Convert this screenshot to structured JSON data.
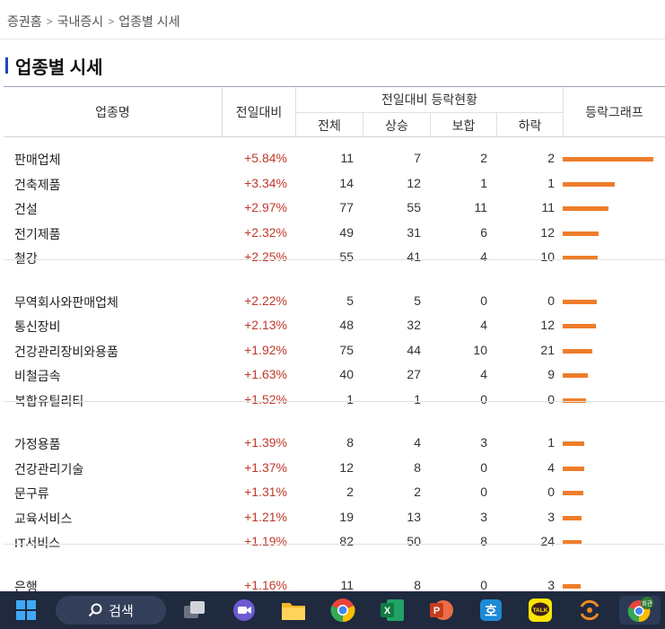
{
  "breadcrumb": [
    "증권홈",
    "국내증시",
    "업종별 시세"
  ],
  "page_title": "업종별 시세",
  "table": {
    "headers": {
      "name": "업종명",
      "change": "전일대비",
      "group": "전일대비 등락현황",
      "total": "전체",
      "up": "상승",
      "flat": "보합",
      "down": "하락",
      "graph": "등락그래프"
    },
    "groups": [
      [
        {
          "name": "판매업체",
          "change": "+5.84%",
          "total": "11",
          "up": "7",
          "flat": "2",
          "down": "2",
          "pct": 5.84
        },
        {
          "name": "건축제품",
          "change": "+3.34%",
          "total": "14",
          "up": "12",
          "flat": "1",
          "down": "1",
          "pct": 3.34
        },
        {
          "name": "건설",
          "change": "+2.97%",
          "total": "77",
          "up": "55",
          "flat": "11",
          "down": "11",
          "pct": 2.97
        },
        {
          "name": "전기제품",
          "change": "+2.32%",
          "total": "49",
          "up": "31",
          "flat": "6",
          "down": "12",
          "pct": 2.32
        },
        {
          "name": "철강",
          "change": "+2.25%",
          "total": "55",
          "up": "41",
          "flat": "4",
          "down": "10",
          "pct": 2.25
        }
      ],
      [
        {
          "name": "무역회사와판매업체",
          "change": "+2.22%",
          "total": "5",
          "up": "5",
          "flat": "0",
          "down": "0",
          "pct": 2.22
        },
        {
          "name": "통신장비",
          "change": "+2.13%",
          "total": "48",
          "up": "32",
          "flat": "4",
          "down": "12",
          "pct": 2.13
        },
        {
          "name": "건강관리장비와용품",
          "change": "+1.92%",
          "total": "75",
          "up": "44",
          "flat": "10",
          "down": "21",
          "pct": 1.92
        },
        {
          "name": "비철금속",
          "change": "+1.63%",
          "total": "40",
          "up": "27",
          "flat": "4",
          "down": "9",
          "pct": 1.63
        },
        {
          "name": "복합유틸리티",
          "change": "+1.52%",
          "total": "1",
          "up": "1",
          "flat": "0",
          "down": "0",
          "pct": 1.52
        }
      ],
      [
        {
          "name": "가정용품",
          "change": "+1.39%",
          "total": "8",
          "up": "4",
          "flat": "3",
          "down": "1",
          "pct": 1.39
        },
        {
          "name": "건강관리기술",
          "change": "+1.37%",
          "total": "12",
          "up": "8",
          "flat": "0",
          "down": "4",
          "pct": 1.37
        },
        {
          "name": "문구류",
          "change": "+1.31%",
          "total": "2",
          "up": "2",
          "flat": "0",
          "down": "0",
          "pct": 1.31
        },
        {
          "name": "교육서비스",
          "change": "+1.21%",
          "total": "19",
          "up": "13",
          "flat": "3",
          "down": "3",
          "pct": 1.21
        },
        {
          "name": "IT서비스",
          "change": "+1.19%",
          "total": "82",
          "up": "50",
          "flat": "8",
          "down": "24",
          "pct": 1.19
        }
      ],
      [
        {
          "name": "은행",
          "change": "+1.16%",
          "total": "11",
          "up": "8",
          "flat": "0",
          "down": "3",
          "pct": 1.16
        }
      ]
    ]
  },
  "colors": {
    "up": "#c0392b",
    "graph_bar": "#ef7d2a",
    "title_bar": "#1c49b8",
    "taskbar": "#1f2a3f"
  },
  "taskbar": {
    "search_label": "검색",
    "apps": [
      "windows-start",
      "task-view",
      "video-call",
      "file-explorer",
      "chrome",
      "excel",
      "powerpoint",
      "hangul",
      "kakaotalk",
      "app-orange",
      "chrome-profile"
    ],
    "profile_badge": "회관",
    "hangul_glyph": "호",
    "kakao_label": "TALK"
  }
}
